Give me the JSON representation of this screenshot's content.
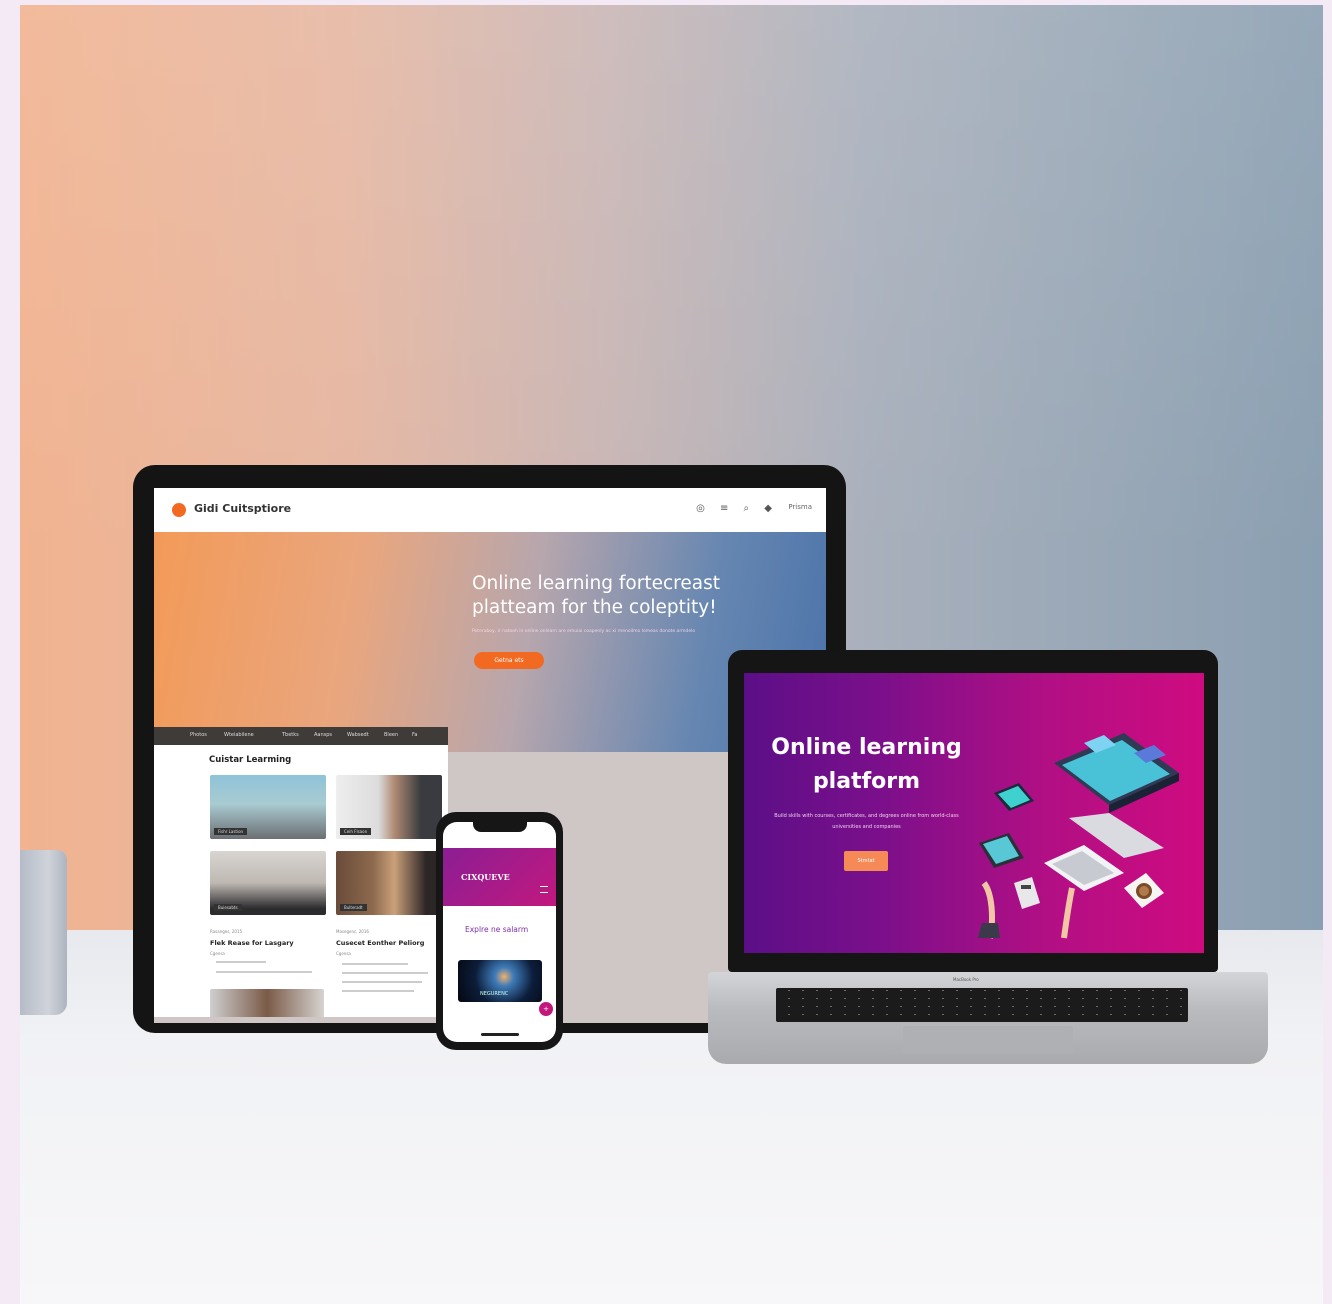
{
  "scene": {
    "colors": {
      "backdrop_left": "#f1b390",
      "backdrop_right": "#8a9fb1",
      "desk": "#eef0f3",
      "accent_orange": "#f26a21",
      "accent_magenta": "#c2187e",
      "accent_purple": "#5b0f87"
    }
  },
  "monitor": {
    "brand": "Gidi Cuitsptiore",
    "nav_icons": "◎ ≡ ⌕ ◆",
    "nav_button": "Prisma",
    "hero": {
      "title_line1": "Online learning fortecreast",
      "title_line2": "platteam for the coleptity!",
      "subtitle": "Poteraboy, ir natoeh in online onlearn are emuiai coapenly ac xi rnenoilmo lomeas donote armdelo",
      "button": "Getna ets"
    }
  },
  "tablet_page": {
    "menu": [
      "Photos",
      "Wteiabilene",
      "Tbetks",
      "Aansps",
      "Wabsedt",
      "Bleen",
      "Fa"
    ],
    "section_title": "Cuistar Learming",
    "card_captions": [
      "Fishr Lastion",
      "Ceih Flsaon",
      "Buiesabts",
      "Bulteradt"
    ],
    "posts": [
      {
        "meta": "Rasanges, 2015",
        "title": "Flek Rease for Lasgary",
        "sub": "Cgensa"
      },
      {
        "meta": "Masegenc, 2016",
        "title": "Cusecet Eonther Peliorg",
        "sub": "Cgensa"
      }
    ]
  },
  "phone": {
    "brand": "CIXQUEVE",
    "explore": "Explre ne salarm",
    "card_label": "NEGURENC",
    "fab": "+"
  },
  "laptop": {
    "title_line1": "Online learning",
    "title_line2": "platform",
    "subtitle": "Build skills with courses, certificates, and degrees online from world-class universities and companies",
    "button": "Stmtat",
    "brandmark": "MacBook Pro"
  }
}
